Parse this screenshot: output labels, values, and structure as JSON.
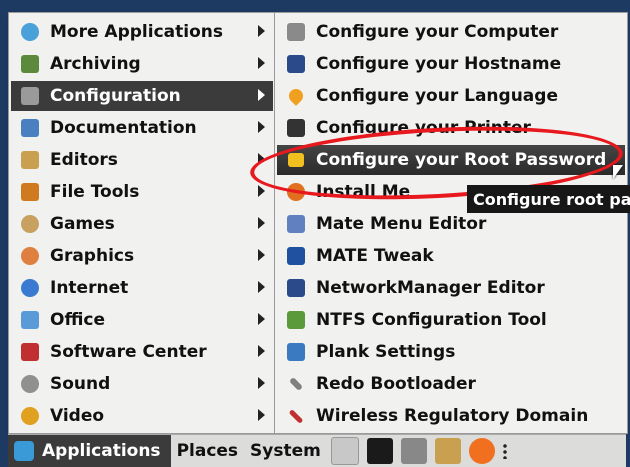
{
  "left_menu": {
    "items": [
      {
        "label": "More Applications",
        "icon": "more-applications-icon",
        "color": "#4aa0d8"
      },
      {
        "label": "Archiving",
        "icon": "archive-icon",
        "color": "#5a8a3a"
      },
      {
        "label": "Configuration",
        "icon": "configuration-icon",
        "color": "#9a9a9a"
      },
      {
        "label": "Documentation",
        "icon": "documentation-icon",
        "color": "#4a7fc0"
      },
      {
        "label": "Editors",
        "icon": "editor-icon",
        "color": "#c8a050"
      },
      {
        "label": "File Tools",
        "icon": "file-tools-icon",
        "color": "#d07a20"
      },
      {
        "label": "Games",
        "icon": "games-icon",
        "color": "#c8a060"
      },
      {
        "label": "Graphics",
        "icon": "graphics-icon",
        "color": "#e08040"
      },
      {
        "label": "Internet",
        "icon": "internet-icon",
        "color": "#3a7ad0"
      },
      {
        "label": "Office",
        "icon": "office-icon",
        "color": "#5a9ad8"
      },
      {
        "label": "Software Center",
        "icon": "software-center-icon",
        "color": "#c03030"
      },
      {
        "label": "Sound",
        "icon": "sound-icon",
        "color": "#909090"
      },
      {
        "label": "Video",
        "icon": "video-icon",
        "color": "#e0a020"
      }
    ]
  },
  "right_menu": {
    "items": [
      {
        "label": "Configure your Computer",
        "icon": "computer-config-icon",
        "color": "#8a8a8a"
      },
      {
        "label": "Configure your Hostname",
        "icon": "hostname-icon",
        "color": "#2a4a8a"
      },
      {
        "label": "Configure your Language",
        "icon": "location-pin-icon",
        "color": "#f0a020"
      },
      {
        "label": "Configure your Printer",
        "icon": "printer-icon",
        "color": "#333333"
      },
      {
        "label": "Configure your Root Password",
        "icon": "lock-icon",
        "color": "#f0c020"
      },
      {
        "label": "Install Me",
        "icon": "install-icon",
        "color": "#e07020"
      },
      {
        "label": "Mate Menu Editor",
        "icon": "menu-editor-icon",
        "color": "#6080c0"
      },
      {
        "label": "MATE Tweak",
        "icon": "tweak-icon",
        "color": "#2050a0"
      },
      {
        "label": "NetworkManager Editor",
        "icon": "network-icon",
        "color": "#2a4a8a"
      },
      {
        "label": "NTFS Configuration Tool",
        "icon": "ntfs-icon",
        "color": "#5a9a3a"
      },
      {
        "label": "Plank Settings",
        "icon": "plank-icon",
        "color": "#3a7ac0"
      },
      {
        "label": "Redo Bootloader",
        "icon": "wrench-icon",
        "color": "#808080"
      },
      {
        "label": "Wireless Regulatory Domain",
        "icon": "tools-icon",
        "color": "#c03030"
      }
    ]
  },
  "tooltip": "Configure root pas",
  "panel": {
    "applications": "Applications",
    "places": "Places",
    "system": "System",
    "launchers": [
      "file-manager-icon",
      "terminal-icon",
      "mixer-icon",
      "files-icon",
      "firefox-icon"
    ]
  },
  "colors": {
    "highlight": "#3b3b3b",
    "annotation": "#e8191e"
  }
}
